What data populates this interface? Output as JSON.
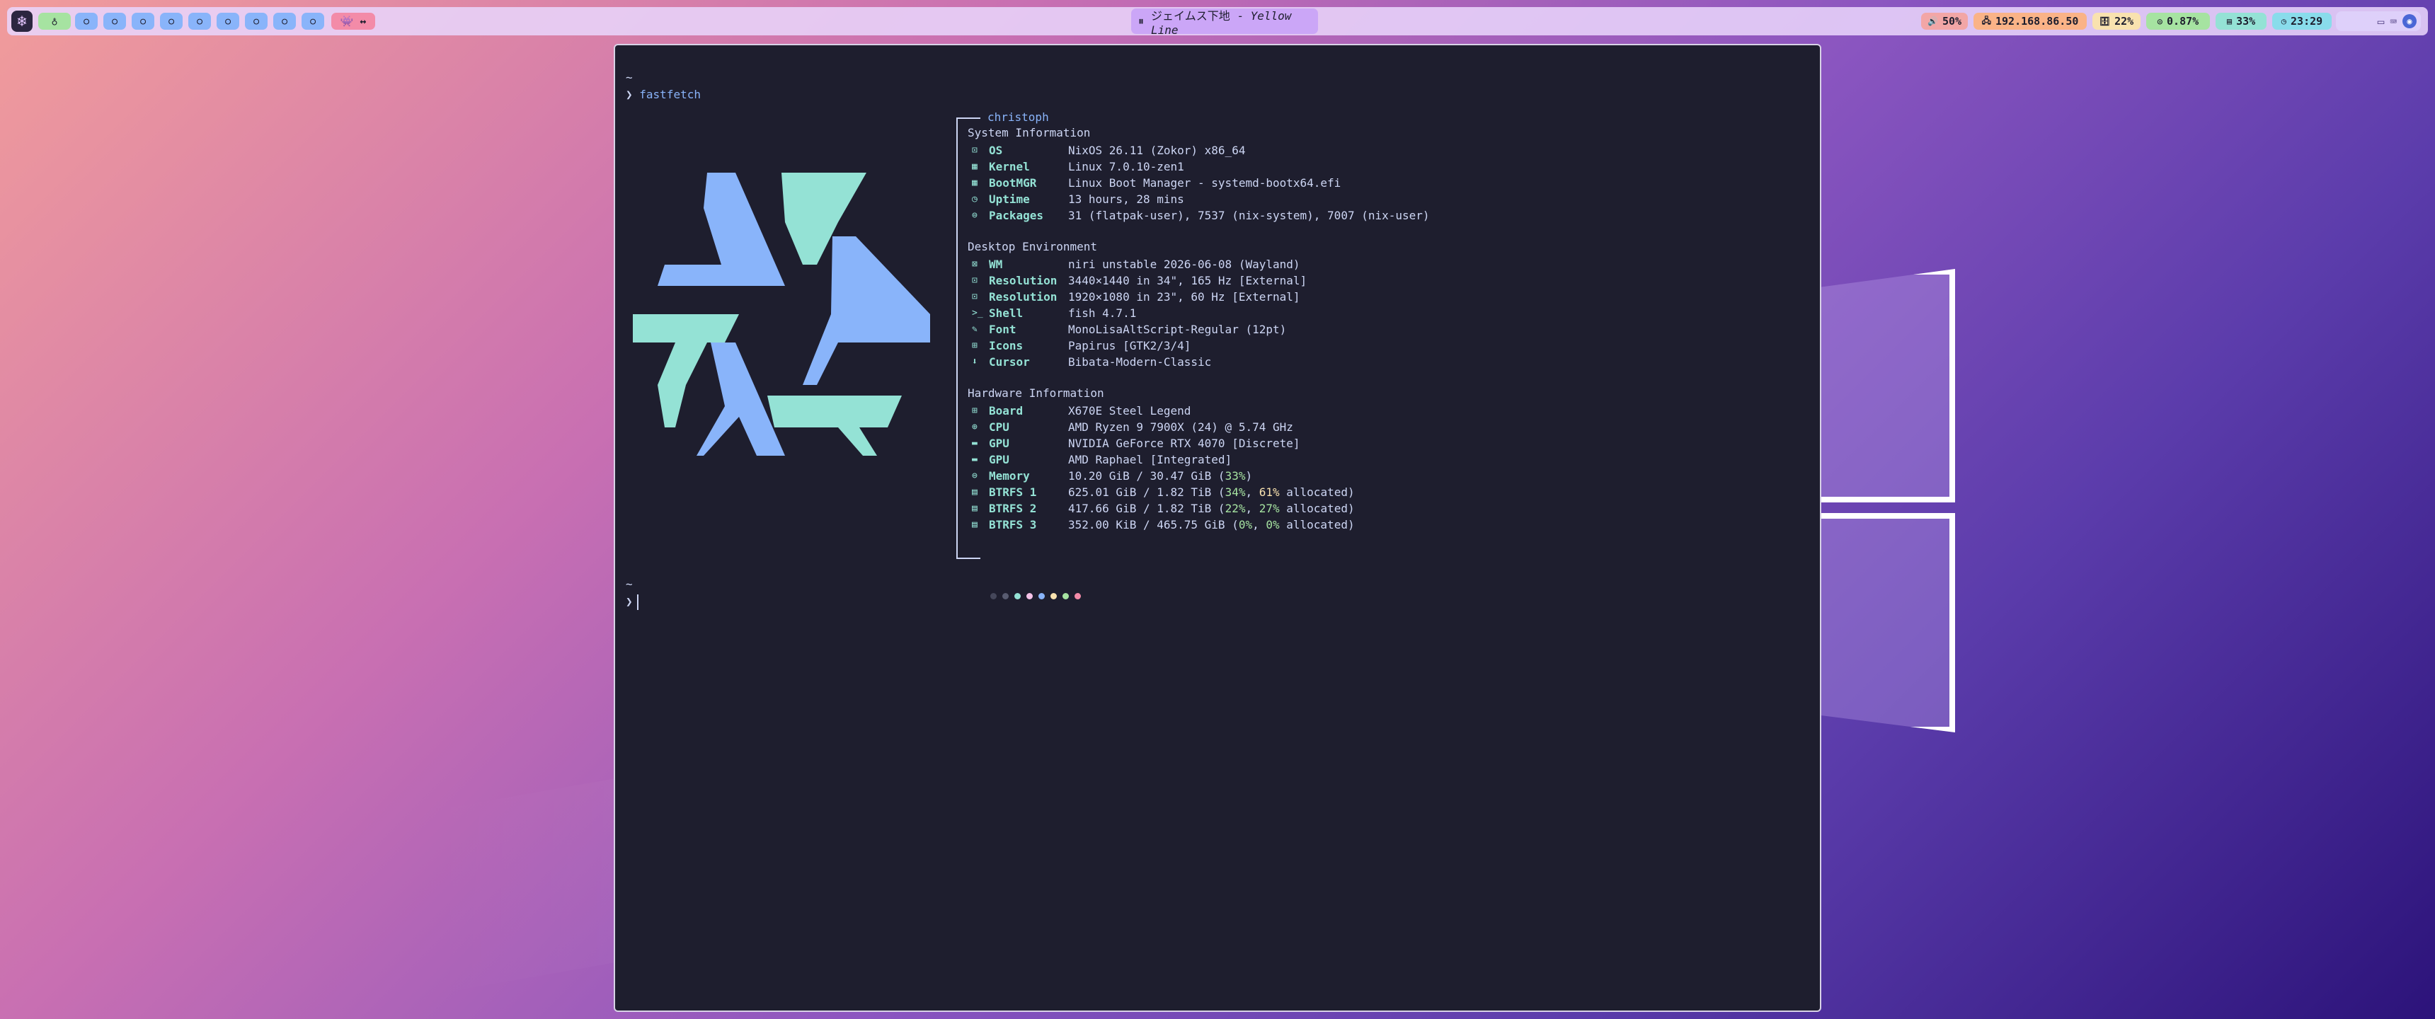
{
  "topbar": {
    "logo_glyph": "❄",
    "workspaces": [
      "♁",
      "○",
      "○",
      "○",
      "○",
      "○",
      "○",
      "○",
      "○",
      "○"
    ],
    "special_ws": "👾 ↔",
    "media": {
      "icon": "⏸",
      "title": "ジェイムス下地",
      "separator": " - ",
      "artist": "Yellow Line"
    },
    "status": [
      {
        "id": "volume",
        "icon": "🔊",
        "text": "50%",
        "color": "#f2a6a6"
      },
      {
        "id": "network",
        "icon": "🖧",
        "text": "192.168.86.50",
        "color": "#fab387"
      },
      {
        "id": "disk",
        "icon": "🗄",
        "text": "22%",
        "color": "#f9e2af"
      },
      {
        "id": "cpu",
        "icon": "◎",
        "text": "0.87%",
        "color": "#a6e3a1"
      },
      {
        "id": "memory",
        "icon": "▤",
        "text": "33%",
        "color": "#94e2d5"
      },
      {
        "id": "clock",
        "icon": "◷",
        "text": "23:29",
        "color": "#89dceb"
      }
    ],
    "tray": [
      "▭",
      "⌨",
      "◉"
    ]
  },
  "terminal": {
    "prompt_symbol": "❯",
    "cwd": "~",
    "command": "fastfetch",
    "username": "christoph",
    "sections": [
      {
        "title": "System Information",
        "rows": [
          {
            "icon": "⊡",
            "key": "OS",
            "value": "NixOS 26.11 (Zokor) x86_64"
          },
          {
            "icon": "▦",
            "key": "Kernel",
            "value": "Linux 7.0.10-zen1"
          },
          {
            "icon": "▦",
            "key": "BootMGR",
            "value": "Linux Boot Manager - systemd-bootx64.efi"
          },
          {
            "icon": "◷",
            "key": "Uptime",
            "value": "13 hours, 28 mins"
          },
          {
            "icon": "⊜",
            "key": "Packages",
            "value": "31 (flatpak-user), 7537 (nix-system), 7007 (nix-user)"
          }
        ]
      },
      {
        "title": "Desktop Environment",
        "rows": [
          {
            "icon": "⊠",
            "key": "WM",
            "value": "niri unstable 2026-06-08 (Wayland)"
          },
          {
            "icon": "⊡",
            "key": "Resolution",
            "value": "3440×1440 in 34\", 165 Hz [External]"
          },
          {
            "icon": "⊡",
            "key": "Resolution",
            "value": "1920×1080 in 23\", 60 Hz [External]"
          },
          {
            "icon": ">_",
            "key": "Shell",
            "value": "fish 4.7.1"
          },
          {
            "icon": "✎",
            "key": "Font",
            "value": "MonoLisaAltScript-Regular (12pt)"
          },
          {
            "icon": "⊞",
            "key": "Icons",
            "value": "Papirus [GTK2/3/4]"
          },
          {
            "icon": "⬇",
            "key": "Cursor",
            "value": "Bibata-Modern-Classic"
          }
        ]
      },
      {
        "title": "Hardware Information",
        "rows": [
          {
            "icon": "⊞",
            "key": "Board",
            "value": "X670E Steel Legend"
          },
          {
            "icon": "⊕",
            "key": "CPU",
            "value": "AMD Ryzen 9 7900X (24) @ 5.74 GHz"
          },
          {
            "icon": "▬",
            "key": "GPU",
            "value": "NVIDIA GeForce RTX 4070 [Discrete]"
          },
          {
            "icon": "▬",
            "key": "GPU",
            "value": "AMD Raphael [Integrated]"
          },
          {
            "icon": "⊜",
            "key": "Memory",
            "value": "10.20 GiB / 30.47 GiB (",
            "pcts": [
              "33%"
            ],
            "tail": ")"
          },
          {
            "icon": "▤",
            "key": "BTRFS 1",
            "value": "625.01 GiB / 1.82 TiB (",
            "pcts": [
              "34%",
              "61%"
            ],
            "tail": " allocated)"
          },
          {
            "icon": "▤",
            "key": "BTRFS 2",
            "value": "417.66 GiB / 1.82 TiB (",
            "pcts": [
              "22%",
              "27%"
            ],
            "tail": " allocated)"
          },
          {
            "icon": "▤",
            "key": "BTRFS 3",
            "value": "352.00 KiB / 465.75 GiB (",
            "pcts": [
              "0%",
              "0%"
            ],
            "tail": " allocated)"
          }
        ]
      }
    ],
    "palette": [
      "#45475a",
      "#585b70",
      "#94e2d5",
      "#f5c2e7",
      "#89b4fa",
      "#f9e2af",
      "#a6e3a1",
      "#f38ba8"
    ],
    "logo_colors": {
      "blue": "#89b4fa",
      "teal": "#94e2d5"
    }
  }
}
